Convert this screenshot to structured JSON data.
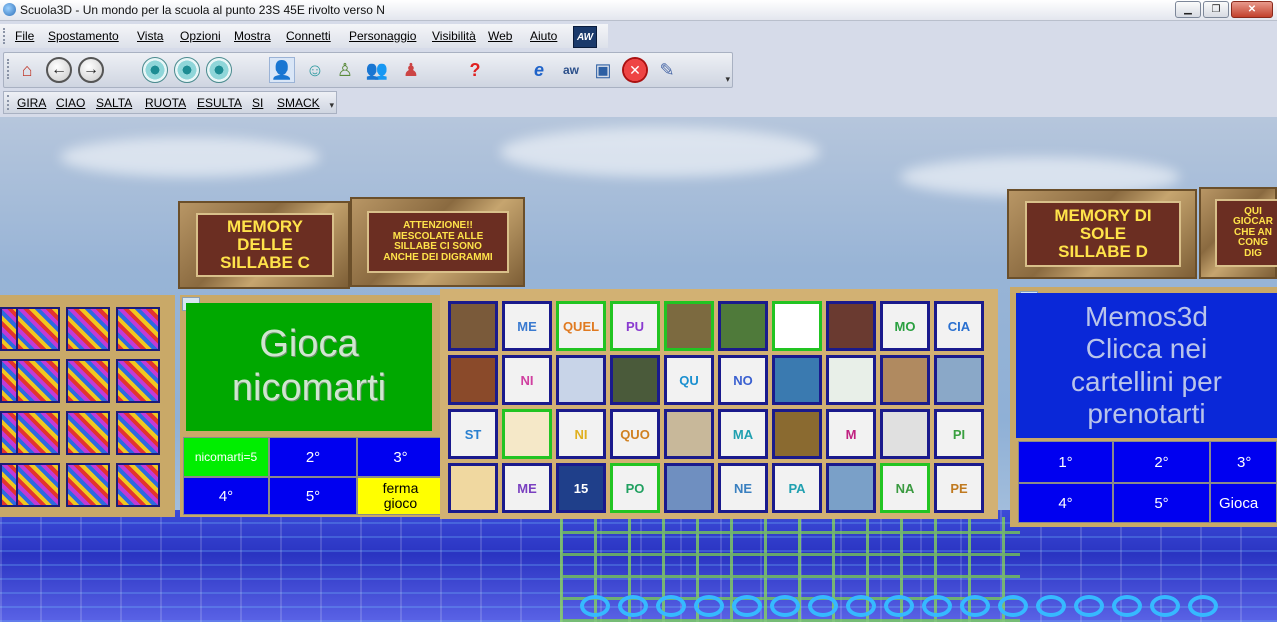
{
  "window": {
    "title": "Scuola3D  - Un mondo per la scuola al punto 23S 45E  rivolto verso N"
  },
  "menu": [
    "File",
    "Spostamento",
    "Vista",
    "Opzioni",
    "Mostra",
    "Connetti",
    "Personaggio",
    "Visibilità",
    "Web",
    "Aiuto"
  ],
  "logo": "AW",
  "actions": [
    "GIRA",
    "CIAO",
    "SALTA",
    "RUOTA",
    "ESULTA",
    "SI",
    "SMACK"
  ],
  "signs": {
    "left_title": "MEMORY\nDELLE\nSILLABE  C",
    "left_note": "ATTENZIONE!!\nMESCOLATE ALLE\nSILLABE CI SONO\nANCHE DEI DIGRAMMI",
    "right_title": "MEMORY DI\nSOLE\nSILLABE  D",
    "right_note": "QUI\nGIOCAR\nCHE AN\nCONG\nDIG"
  },
  "game_board": {
    "display": "Gioca\nnicomarti",
    "cells": [
      "nicomarti=5",
      "2°",
      "3°",
      "4°",
      "5°",
      "ferma\ngioco"
    ]
  },
  "right_board": {
    "display": "Memos3d\nClicca nei\ncartellini per\nprenotarti",
    "cells": [
      "1°",
      "2°",
      "3°",
      "4°",
      "5°",
      "Gioca"
    ]
  },
  "memory_tiles": [
    "",
    "ME",
    "QUEL",
    "PU",
    "",
    "",
    "",
    "",
    "MO",
    "CIA",
    "",
    "NI",
    "",
    "",
    "QU",
    "NO",
    "",
    "",
    "",
    "",
    "ST",
    "",
    "NI",
    "QUO",
    "",
    "MA",
    "",
    "M",
    "",
    "PI",
    "",
    "ME",
    "15",
    "PO",
    "",
    "NE",
    "PA",
    "",
    "NA",
    "PE"
  ],
  "toolbar_icons": [
    "home-icon",
    "back-icon",
    "forward-icon",
    "eye-icon",
    "eye-icon",
    "eye-icon",
    "avatar-icon",
    "look-icon",
    "person-icon",
    "people-icon",
    "friends-icon",
    "help-icon",
    "browser-icon",
    "chat-icon",
    "camera-icon",
    "stop-icon",
    "mouse-icon"
  ]
}
